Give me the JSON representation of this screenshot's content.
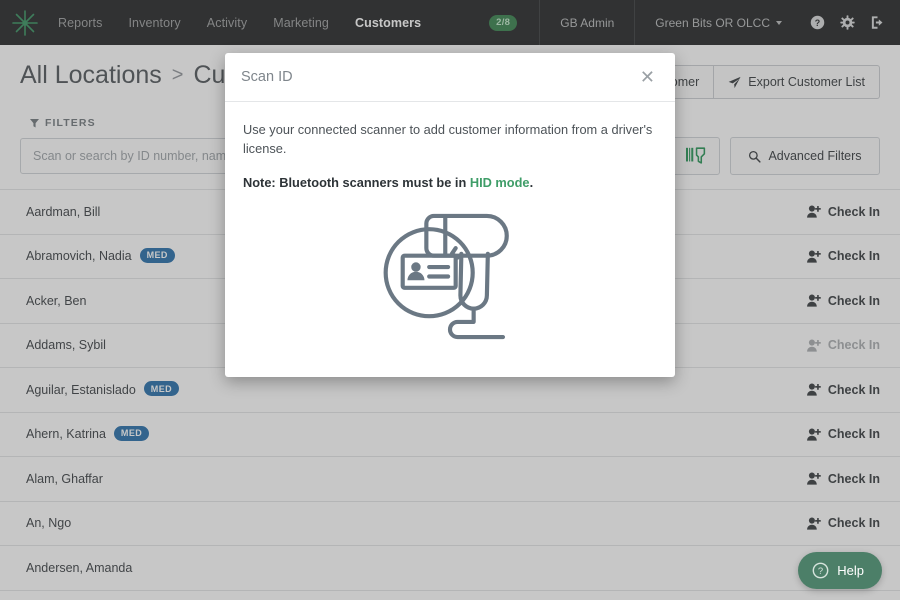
{
  "topnav": {
    "logo_icon": "starburst-logo-icon",
    "links": [
      {
        "label": "Reports",
        "active": false
      },
      {
        "label": "Inventory",
        "active": false
      },
      {
        "label": "Activity",
        "active": false
      },
      {
        "label": "Marketing",
        "active": false
      },
      {
        "label": "Customers",
        "active": true
      }
    ],
    "count_badge": "2/8",
    "admin_label": "GB Admin",
    "org_label": "Green Bits OR OLCC",
    "icons": [
      "help-circle-icon",
      "gear-icon",
      "logout-icon"
    ],
    "background_color": "#1c1e1f",
    "active_link_color": "#ffffff",
    "badge_color": "#2f7d46"
  },
  "page_header": {
    "breadcrumb_root": "All Locations",
    "breadcrumb_separator": ">",
    "breadcrumb_current": "Customers",
    "add_customer_label": "Add Customer",
    "export_label": "Export Customer List",
    "export_icon": "paper-plane-icon"
  },
  "filters": {
    "label": "FILTERS",
    "filter_icon": "funnel-icon",
    "search_placeholder": "Scan or search by ID number, name, phone",
    "search_value": "",
    "scan_icon": "barcode-scanner-icon",
    "scan_icon_color": "#1e9150",
    "advanced_label": "Advanced Filters",
    "advanced_icon": "magnifier-icon"
  },
  "customers": {
    "check_in_label": "Check In",
    "check_in_icon": "person-add-icon",
    "med_badge_label": "MED",
    "med_badge_color": "#1f6aa8",
    "rows": [
      {
        "name": "Aardman, Bill",
        "med": false,
        "check_in_enabled": true
      },
      {
        "name": "Abramovich, Nadia",
        "med": true,
        "check_in_enabled": true
      },
      {
        "name": "Acker, Ben",
        "med": false,
        "check_in_enabled": true
      },
      {
        "name": "Addams, Sybil",
        "med": false,
        "check_in_enabled": false
      },
      {
        "name": "Aguilar, Estanislado",
        "med": true,
        "check_in_enabled": true
      },
      {
        "name": "Ahern, Katrina",
        "med": true,
        "check_in_enabled": true
      },
      {
        "name": "Alam, Ghaffar",
        "med": false,
        "check_in_enabled": true
      },
      {
        "name": "An, Ngo",
        "med": false,
        "check_in_enabled": true
      },
      {
        "name": "Andersen, Amanda",
        "med": false,
        "check_in_enabled": true
      }
    ]
  },
  "modal": {
    "title": "Scan ID",
    "close_icon": "close-icon",
    "body_text": "Use your connected scanner to add customer information from a driver's license.",
    "note_prefix": "Note: Bluetooth scanners must be in ",
    "note_link": "HID mode",
    "note_suffix": ".",
    "illustration_icon": "id-scanner-illustration",
    "link_color": "#3f9d68"
  },
  "help_widget": {
    "label": "Help",
    "icon": "question-circle-icon",
    "color": "#4c7f68"
  }
}
